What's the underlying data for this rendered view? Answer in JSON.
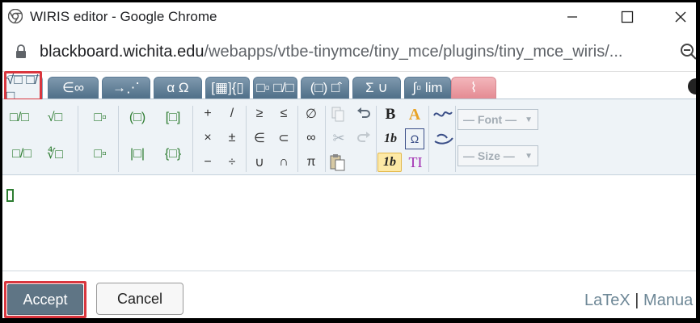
{
  "window": {
    "title": "WIRIS editor - Google Chrome",
    "controls": [
      "minimize-icon",
      "maximize-icon",
      "close-icon"
    ]
  },
  "address": {
    "host": "blackboard.wichita.edu",
    "path": "/webapps/vtbe-tinymce/tiny_mce/plugins/tiny_mce_wiris/..."
  },
  "tabs": [
    {
      "label": "√□ □/□",
      "active": true
    },
    {
      "label": "∈∞"
    },
    {
      "label": "→⋰"
    },
    {
      "label": "α Ω"
    },
    {
      "label": "[▦]{▯"
    },
    {
      "label": "□▫ □/□"
    },
    {
      "label": "(□) □̂"
    },
    {
      "label": "Σ ∪"
    },
    {
      "label": "∫▫ lim"
    },
    {
      "label": "⌇"
    }
  ],
  "toolbar": {
    "group1": [
      "□/□",
      "√□",
      "□/□",
      "∜□"
    ],
    "group2": [
      "□▫",
      "□▫"
    ],
    "group3": [
      "(□)",
      "[□]",
      "|□|",
      "{□}"
    ],
    "operators": [
      "+",
      "/",
      "×",
      "±",
      "−",
      "÷"
    ],
    "relations": [
      "≥",
      "≤",
      "∈",
      "⊂",
      "∪",
      "∩"
    ],
    "symbols": [
      "∅",
      "∞",
      "π"
    ],
    "edit": [
      "copy-icon",
      "undo-icon",
      "cut-icon",
      "redo-icon",
      "paste-icon"
    ],
    "format": {
      "bold": "B",
      "italic": "1b",
      "italic_selected": "1b",
      "text": "TI",
      "color": "A"
    },
    "rtl": [
      "rtl-icon",
      "arabic-icon"
    ],
    "font_select": "— Font —",
    "size_select": "— Size —"
  },
  "footer": {
    "accept": "Accept",
    "cancel": "Cancel",
    "latex": "LaTeX",
    "separator": "|",
    "manual": "Manua"
  },
  "colors": {
    "tab_active_bg": "#eef3f7",
    "tab_bg": "#5f7d95",
    "accept_bg": "#5f7585",
    "highlight": "#d9363e"
  }
}
